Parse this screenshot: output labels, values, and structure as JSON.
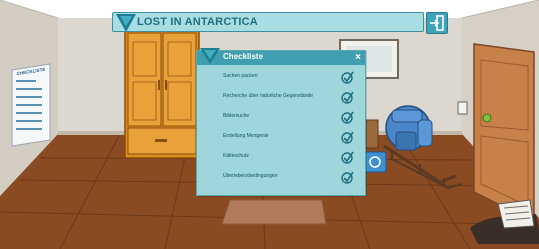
{
  "header": {
    "title": "LOST IN ANTARCTICA",
    "exit_icon": "exit-door-icon",
    "logo_icon": "triangle-logo-icon"
  },
  "wall_poster": {
    "title": "CHECKLISTE"
  },
  "checklist": {
    "title": "Checkliste",
    "close_label": "×",
    "items": [
      {
        "label": "Sachen packen",
        "checked": true
      },
      {
        "label": "Recherche über natürliche Gegenstände",
        "checked": true
      },
      {
        "label": "Bildersuche",
        "checked": true
      },
      {
        "label": "Erstellung Mengenie",
        "checked": true
      },
      {
        "label": "Kälteschutz",
        "checked": true
      },
      {
        "label": "Überlebensbedingungen",
        "checked": true
      }
    ]
  },
  "colors": {
    "accent": "#3f9fb1",
    "panel": "#9ed6db",
    "title_bar": "#a9dde4",
    "check": "#1f6f80"
  }
}
